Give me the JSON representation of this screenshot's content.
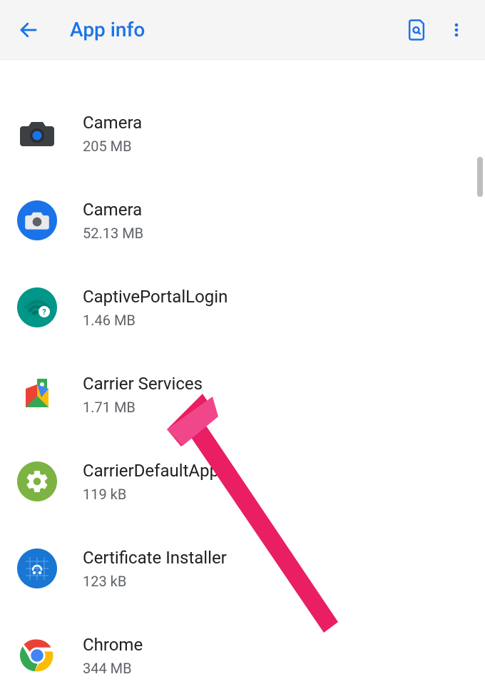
{
  "header": {
    "title": "App info"
  },
  "apps": [
    {
      "name": "Camera",
      "size": "205 MB"
    },
    {
      "name": "Camera",
      "size": "52.13 MB"
    },
    {
      "name": "CaptivePortalLogin",
      "size": "1.46 MB"
    },
    {
      "name": "Carrier Services",
      "size": "1.71 MB"
    },
    {
      "name": "CarrierDefaultApp",
      "size": "119 kB"
    },
    {
      "name": "Certificate Installer",
      "size": "123 kB"
    },
    {
      "name": "Chrome",
      "size": "344 MB"
    }
  ]
}
